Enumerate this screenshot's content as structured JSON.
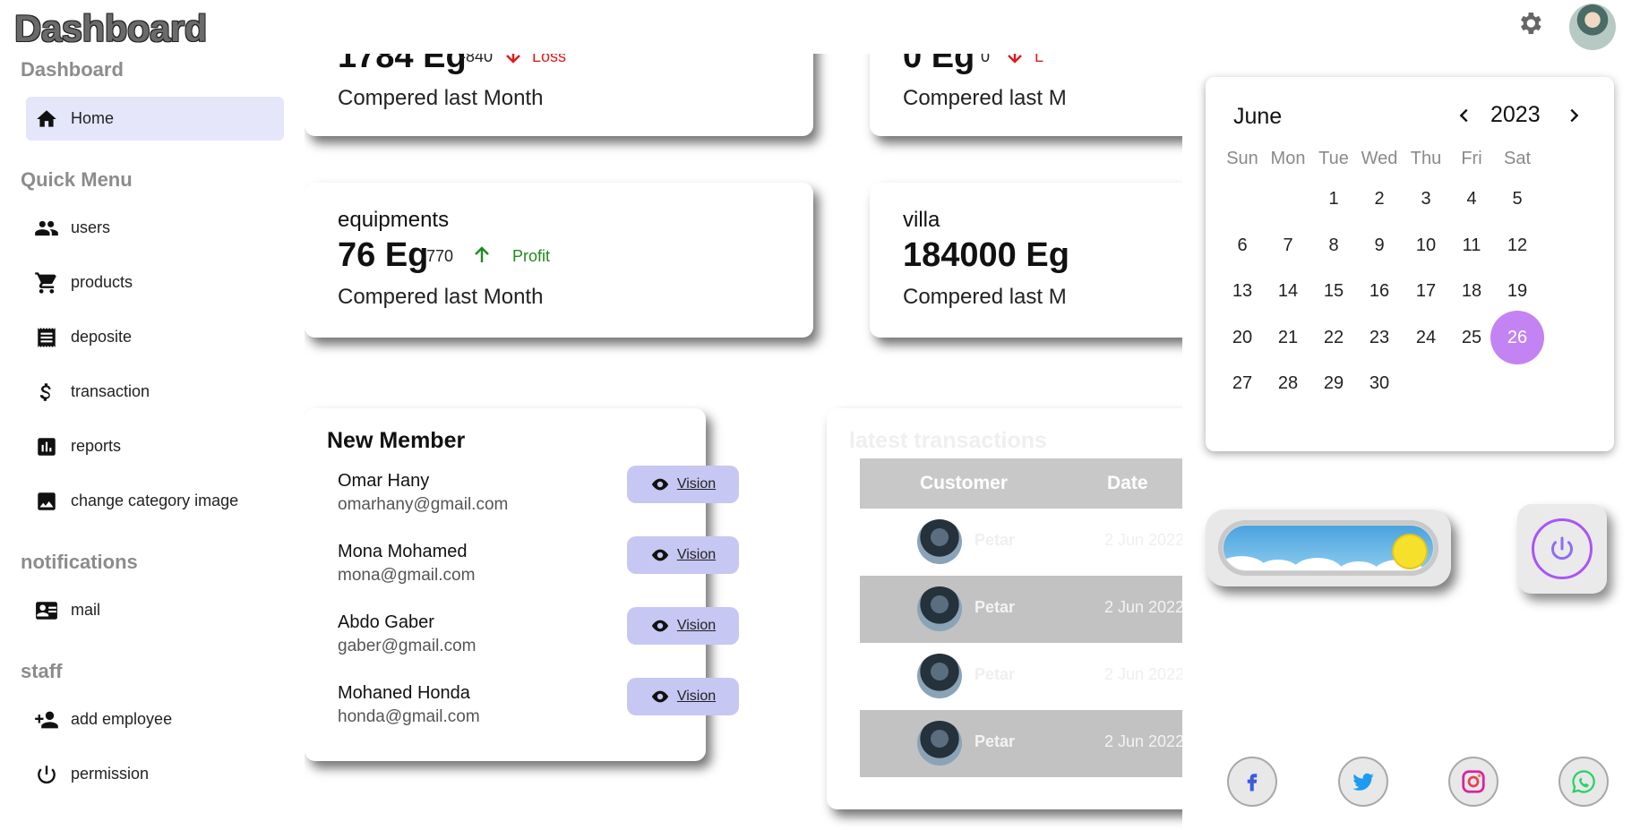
{
  "app": {
    "title": "Dashboard"
  },
  "sidebar": {
    "sections": [
      {
        "title": "Dashboard",
        "items": [
          {
            "label": "Home",
            "icon": "home-icon",
            "active": true
          }
        ]
      },
      {
        "title": "Quick Menu",
        "items": [
          {
            "label": "users",
            "icon": "users-icon"
          },
          {
            "label": "products",
            "icon": "cart-icon"
          },
          {
            "label": "deposite",
            "icon": "receipt-icon"
          },
          {
            "label": "transaction",
            "icon": "dollar-icon"
          },
          {
            "label": "reports",
            "icon": "chart-icon"
          },
          {
            "label": "change category image",
            "icon": "image-icon"
          }
        ]
      },
      {
        "title": "notifications",
        "items": [
          {
            "label": "mail",
            "icon": "contact-mail-icon"
          }
        ]
      },
      {
        "title": "staff",
        "items": [
          {
            "label": "add employee",
            "icon": "person-add-icon"
          },
          {
            "label": "permission",
            "icon": "power-icon"
          }
        ]
      }
    ]
  },
  "stats": [
    {
      "title": "",
      "amount": "1784 Eg",
      "diff": "-840",
      "trend": "Loss",
      "subtitle": "Compered last Month"
    },
    {
      "title": "",
      "amount": "0 Eg",
      "diff": "0",
      "trend": "L",
      "subtitle": "Compered last M"
    },
    {
      "title": "equipments",
      "amount": "76 Eg",
      "diff": "770",
      "trend": "Profit",
      "subtitle": "Compered last Month"
    },
    {
      "title": "villa",
      "amount": "184000 Eg",
      "diff": "",
      "trend": "",
      "subtitle": "Compered last M"
    }
  ],
  "new_member": {
    "title": "New Member",
    "button_label": "Vision",
    "members": [
      {
        "name": "Omar Hany",
        "email": "omarhany@gmail.com"
      },
      {
        "name": "Mona Mohamed",
        "email": "mona@gmail.com"
      },
      {
        "name": "Abdo Gaber",
        "email": "gaber@gmail.com"
      },
      {
        "name": "Mohaned Honda",
        "email": "honda@gmail.com"
      }
    ]
  },
  "transactions": {
    "title": "latest transactions",
    "columns": [
      "Customer",
      "Date"
    ],
    "rows": [
      {
        "name": "Petar",
        "date": "2 Jun 2022"
      },
      {
        "name": "Petar",
        "date": "2 Jun 2022"
      },
      {
        "name": "Petar",
        "date": "2 Jun 2022"
      },
      {
        "name": "Petar",
        "date": "2 Jun 2022"
      }
    ]
  },
  "calendar": {
    "month": "June",
    "year": "2023",
    "weekdays": [
      "Sun",
      "Mon",
      "Tue",
      "Wed",
      "Thu",
      "Fri",
      "Sat"
    ],
    "first_weekday_index": 2,
    "days_in_month": 30,
    "selected_day": 26
  },
  "colors": {
    "accent_purple": "#c483f2",
    "loss_red": "#e01b1b",
    "profit_green": "#1f8a1f",
    "active_item": "#e5e6fa",
    "vision_button": "#c7c7f3"
  },
  "social": [
    {
      "name": "facebook-icon",
      "color": "#3b5bdb"
    },
    {
      "name": "twitter-icon",
      "color": "#1d9bf0"
    },
    {
      "name": "instagram-icon",
      "color": "#d6249f"
    },
    {
      "name": "whatsapp-icon",
      "color": "#25d366"
    }
  ]
}
